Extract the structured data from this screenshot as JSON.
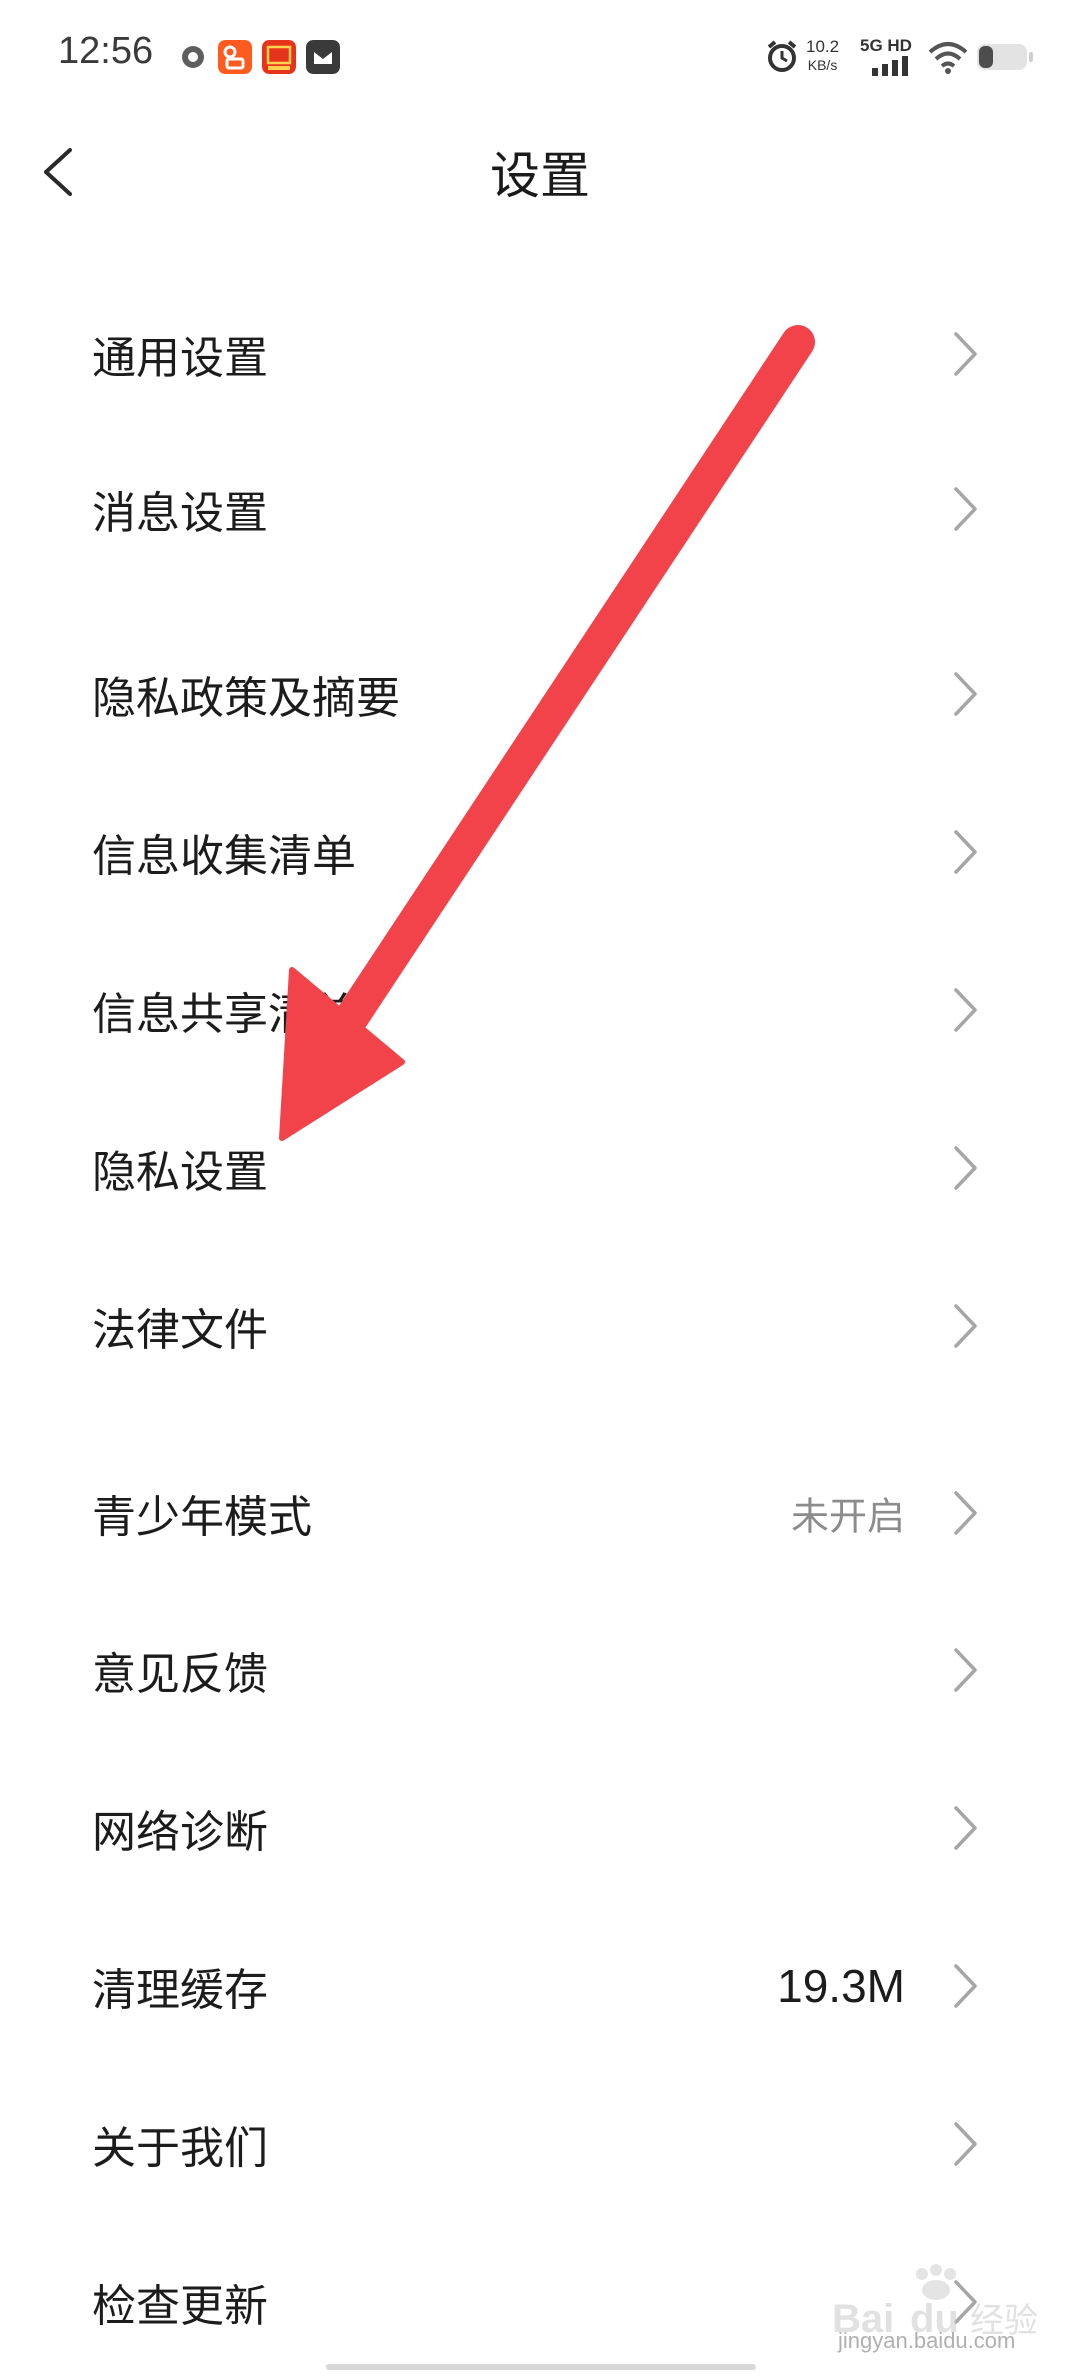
{
  "status_bar": {
    "time": "12:56",
    "net_speed_value": "10.2",
    "net_speed_unit": "KB/s",
    "network": "5G HD",
    "icons": [
      "app-notification-icon",
      "kuaishou-app-icon",
      "taobao-app-icon",
      "message-app-icon",
      "alarm-icon",
      "signal-icon",
      "wifi-icon",
      "battery-icon"
    ]
  },
  "header": {
    "title": "设置",
    "back_icon": "chevron-left-icon"
  },
  "settings": {
    "items": [
      {
        "label": "通用设置",
        "value": ""
      },
      {
        "label": "消息设置",
        "value": ""
      },
      {
        "label": "隐私政策及摘要",
        "value": ""
      },
      {
        "label": "信息收集清单",
        "value": ""
      },
      {
        "label": "信息共享清单",
        "value": ""
      },
      {
        "label": "隐私设置",
        "value": ""
      },
      {
        "label": "法律文件",
        "value": ""
      },
      {
        "label": "青少年模式",
        "value": "未开启"
      },
      {
        "label": "意见反馈",
        "value": ""
      },
      {
        "label": "网络诊断",
        "value": ""
      },
      {
        "label": "清理缓存",
        "value": "19.3M"
      },
      {
        "label": "关于我们",
        "value": ""
      },
      {
        "label": "检查更新",
        "value": ""
      }
    ]
  },
  "annotation": {
    "type": "red-arrow",
    "color": "#f2424a"
  },
  "watermark": {
    "logo_text": "Bai du 经验",
    "url": "jingyan.baidu.com"
  },
  "colors": {
    "background": "#ffffff",
    "text": "#1c1c1c",
    "muted": "#8c8c8c",
    "chevron": "#a6a6a6"
  }
}
